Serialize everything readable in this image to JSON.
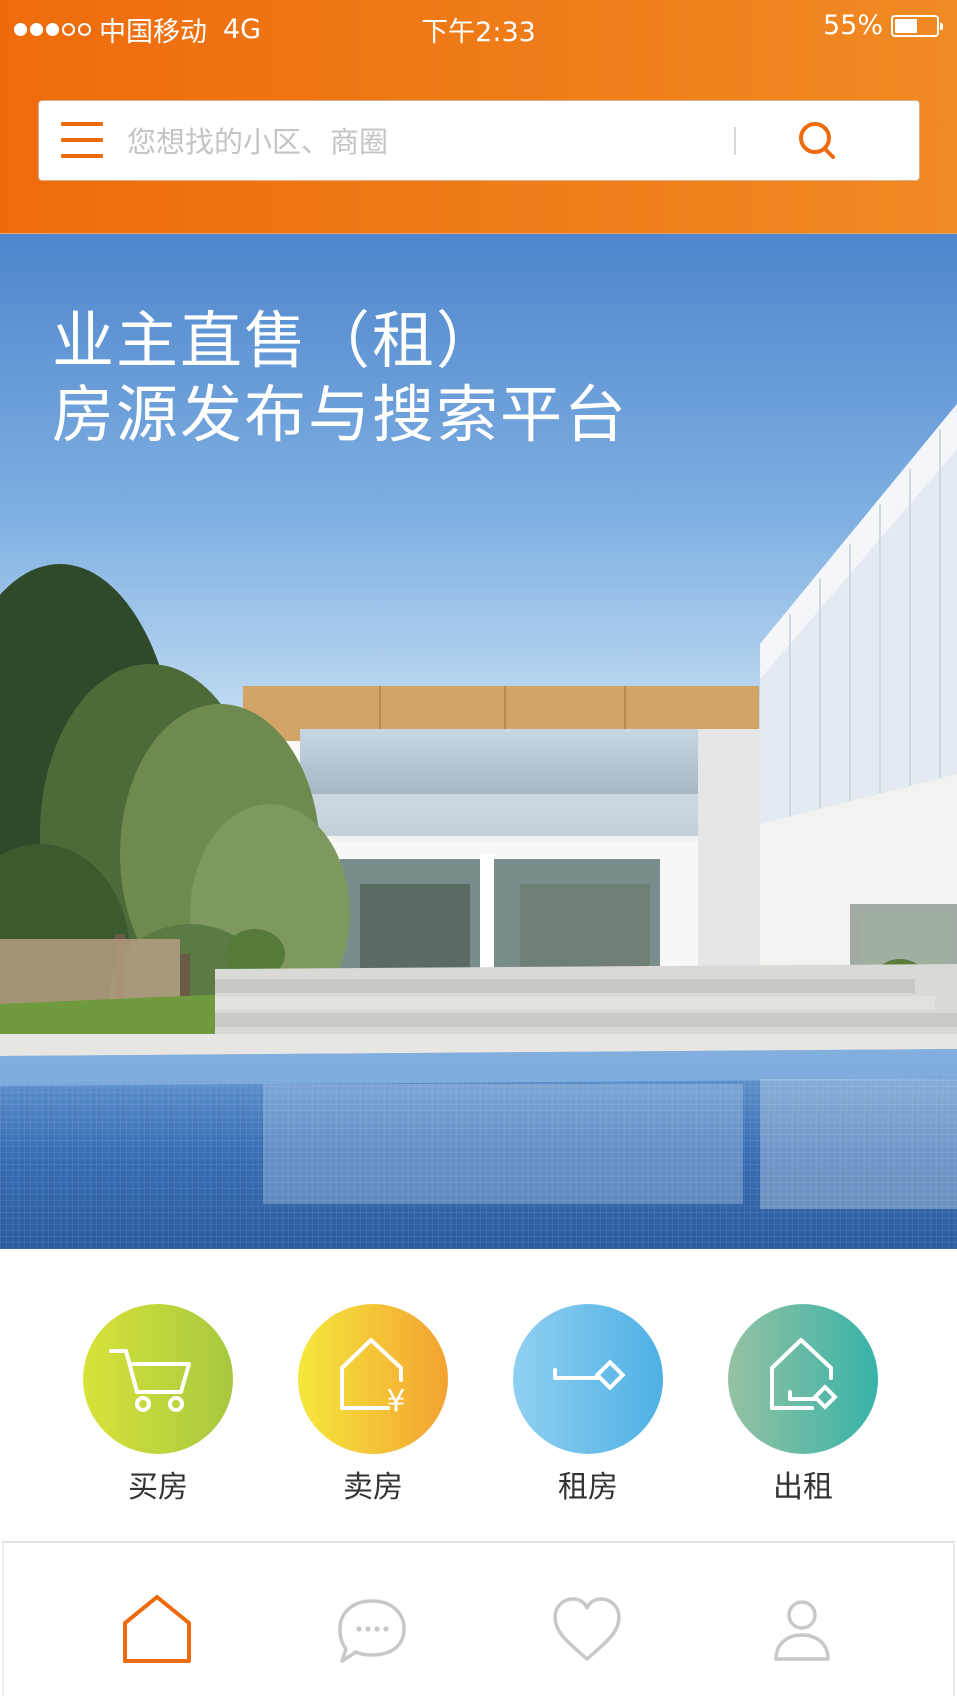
{
  "status_bar": {
    "carrier": "中国移动",
    "network": "4G",
    "time": "下午2:33",
    "battery_percent_text": "55%",
    "battery_level": 0.55,
    "signal_bars_filled": 3,
    "signal_bars_total": 5
  },
  "search": {
    "placeholder": "您想找的小区、商圈",
    "value": "",
    "menu_icon": "menu-icon",
    "search_icon": "search-icon"
  },
  "hero": {
    "title_line1": "业主直售（租）",
    "title_line2": "房源发布与搜索平台"
  },
  "categories": [
    {
      "label": "买房",
      "icon": "shopping-cart-icon",
      "gradient": [
        "#d8e33a",
        "#a6c83f"
      ]
    },
    {
      "label": "卖房",
      "icon": "house-yen-icon",
      "gradient": [
        "#f5e83d",
        "#f3a231"
      ]
    },
    {
      "label": "租房",
      "icon": "key-icon",
      "gradient": [
        "#8fd0f1",
        "#4fb0e4"
      ]
    },
    {
      "label": "出租",
      "icon": "house-key-icon",
      "gradient": [
        "#95c2a3",
        "#36b3a8"
      ]
    }
  ],
  "tabbar": {
    "tabs": [
      {
        "name": "home",
        "icon": "home-icon",
        "active": true
      },
      {
        "name": "messages",
        "icon": "chat-icon",
        "active": false
      },
      {
        "name": "favorites",
        "icon": "heart-icon",
        "active": false
      },
      {
        "name": "profile",
        "icon": "user-icon",
        "active": false
      }
    ]
  },
  "colors": {
    "brand_orange": "#ee6b0d",
    "inactive_icon": "#c8c8c8",
    "text_dark": "#333333"
  }
}
